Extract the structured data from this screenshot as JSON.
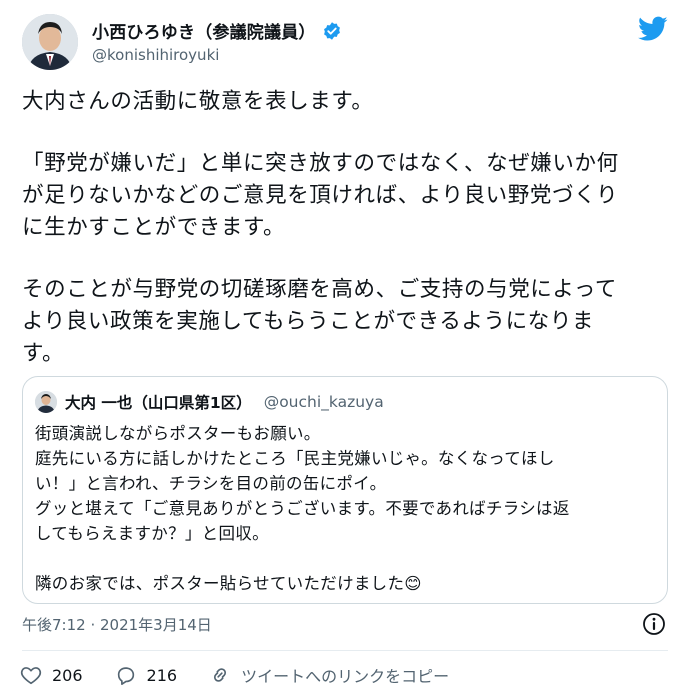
{
  "tweet": {
    "author": {
      "display_name": "小西ひろゆき（参議院議員）",
      "handle": "@konishihiroyuki",
      "verified": true
    },
    "paragraphs": [
      "大内さんの活動に敬意を表します。",
      "「野党が嫌いだ」と単に突き放すのではなく、なぜ嫌いか何\nが足りないかなどのご意見を頂ければ、より良い野党づくり\nに生かすことができます。",
      "そのことが与野党の切磋琢磨を高め、ご支持の与党によって\nより良い政策を実施してもらうことができるようになりま\nす。"
    ],
    "timestamp": "午後7:12 · 2021年3月14日",
    "likes": "206",
    "replies": "216",
    "copy_link_label": "ツイートへのリンクをコピー"
  },
  "quoted": {
    "display_name": "大内 一也（山口県第1区）",
    "handle": "@ouchi_kazuya",
    "text": "街頭演説しながらポスターもお願い。\n庭先にいる方に話しかけたところ「民主党嫌いじゃ。なくなってほし\nい！」と言われ、チラシを目の前の缶にポイ。\nグッと堪えて「ご意見ありがとうございます。不要であればチラシは返\nしてもらえますか？」と回収。\n\n隣のお家では、ポスター貼らせていただけました😊"
  },
  "colors": {
    "brand_blue": "#1d9bf0",
    "text": "#0f1419",
    "muted": "#536471",
    "border": "#cfd9de"
  },
  "icons": [
    "verified-badge-icon",
    "twitter-bird-icon",
    "info-icon",
    "heart-icon",
    "reply-icon",
    "link-icon"
  ]
}
